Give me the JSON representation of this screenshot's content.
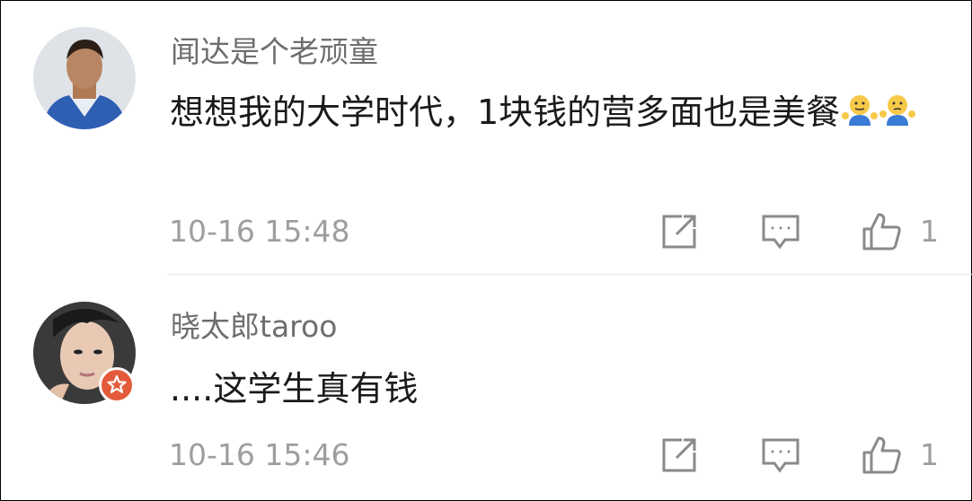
{
  "comments": [
    {
      "username": "闻达是个老顽童",
      "text": "想想我的大学时代，1块钱的营多面也是美餐",
      "emojis": [
        "shrug-emoji",
        "shrug-emoji"
      ],
      "time": "10-16 15:48",
      "likes": "1"
    },
    {
      "username": "晓太郎taroo",
      "text": "....这学生真有钱",
      "time": "10-16 15:46",
      "likes": "1",
      "badge": "verified-badge-icon"
    }
  ],
  "colors": {
    "username": "#6e6e6e",
    "text": "#1a1a1a",
    "meta": "#9e9e9e",
    "badge": "#e35b3a"
  }
}
